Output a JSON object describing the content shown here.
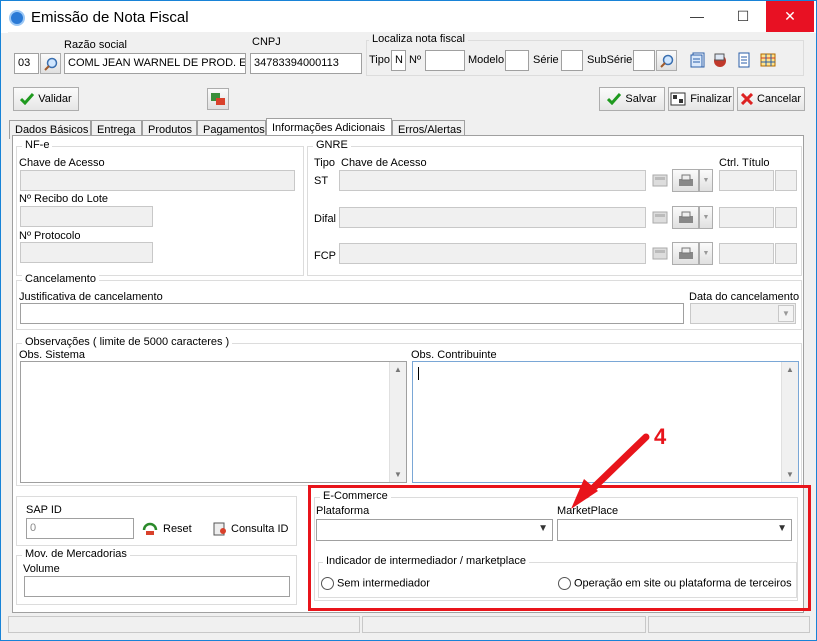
{
  "window": {
    "title": "Emissão de Nota Fiscal",
    "minimize": "—",
    "maximize": "☐",
    "close": "✕"
  },
  "header": {
    "razao_label": "Razão social",
    "cnpj_label": "CNPJ",
    "code_value": "03",
    "razao_value": "COML JEAN WARNEL DE PROD. ESP.",
    "cnpj_value": "34783394000113",
    "localiza_label": "Localiza nota fiscal",
    "tipo_label": "Tipo",
    "tipo_value": "N",
    "numero_label": "Nº",
    "modelo_label": "Modelo",
    "serie_label": "Série",
    "subserie_label": "SubSérie"
  },
  "toolbar": {
    "validar": "Validar",
    "salvar": "Salvar",
    "finalizar": "Finalizar",
    "cancelar": "Cancelar"
  },
  "tabs": [
    {
      "label": "Dados Básicos"
    },
    {
      "label": "Entrega"
    },
    {
      "label": "Produtos"
    },
    {
      "label": "Pagamentos"
    },
    {
      "label": "Informações Adicionais"
    },
    {
      "label": "Erros/Alertas"
    }
  ],
  "nfe": {
    "title": "NF-e",
    "chave_label": "Chave de Acesso",
    "recibo_label": "Nº Recibo do Lote",
    "protocolo_label": "Nº Protocolo"
  },
  "gnre": {
    "title": "GNRE",
    "tipo_label": "Tipo",
    "chave_label": "Chave de Acesso",
    "ctrl_label": "Ctrl. Título",
    "rows": [
      {
        "label": "ST"
      },
      {
        "label": "Difal"
      },
      {
        "label": "FCP"
      }
    ]
  },
  "cancelamento": {
    "title": "Cancelamento",
    "justificativa_label": "Justificativa de cancelamento",
    "data_label": "Data do cancelamento"
  },
  "observacoes": {
    "title": "Observações ( limite de 5000 caracteres )",
    "sistema_label": "Obs. Sistema",
    "contribuinte_label": "Obs. Contribuinte"
  },
  "sap": {
    "label": "SAP ID",
    "value": "0",
    "reset": "Reset",
    "consulta": "Consulta ID"
  },
  "mov": {
    "title": "Mov. de Mercadorias",
    "volume_label": "Volume"
  },
  "ecommerce": {
    "title": "E-Commerce",
    "plataforma_label": "Plataforma",
    "marketplace_label": "MarketPlace",
    "indicador_title": "Indicador de intermediador / marketplace",
    "opt1": "Sem intermediador",
    "opt2": "Operação em site ou plataforma de terceiros"
  },
  "annotation": {
    "number": "4",
    "color": "#e8141b"
  },
  "colors": {
    "accent": "#1883d7",
    "close": "#e81123"
  }
}
